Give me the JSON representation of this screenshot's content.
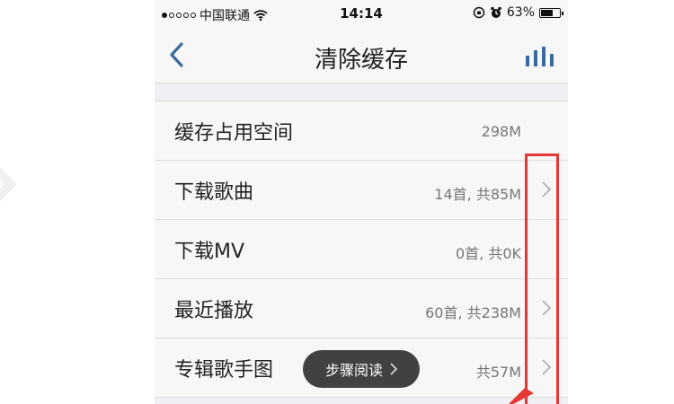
{
  "statusbar": {
    "carrier": "中国联通",
    "time": "14:14",
    "battery": "63%",
    "battery_level": 0.63
  },
  "navbar": {
    "title": "清除缓存"
  },
  "rows": [
    {
      "label": "缓存占用空间",
      "value": "298M",
      "has_chevron": false
    },
    {
      "label": "下载歌曲",
      "value": "14首, 共85M",
      "has_chevron": true
    },
    {
      "label": "下载MV",
      "value": "0首, 共0K",
      "has_chevron": false
    },
    {
      "label": "最近播放",
      "value": "60首, 共238M",
      "has_chevron": true
    },
    {
      "label": "专辑歌手图",
      "value": "共57M",
      "has_chevron": true
    }
  ],
  "overlay": {
    "pill_label": "步骤阅读"
  },
  "colors": {
    "accent_blue": "#3a6a9c",
    "annotation_red": "#e53935"
  }
}
